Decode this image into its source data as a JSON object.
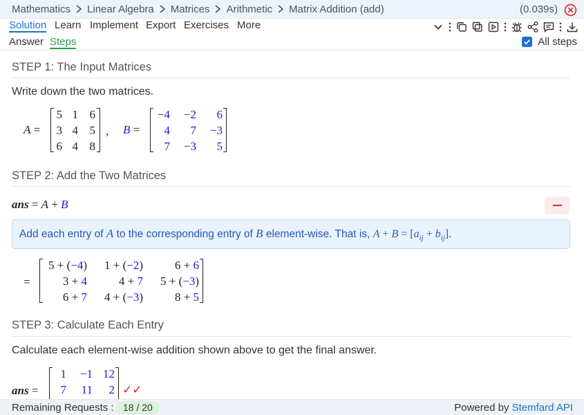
{
  "breadcrumb": [
    "Mathematics",
    "Linear Algebra",
    "Matrices",
    "Arithmetic",
    "Matrix Addition (add)"
  ],
  "timing": "(0.039s)",
  "menu": [
    "Solution",
    "Learn",
    "Implement",
    "Export",
    "Exercises",
    "More"
  ],
  "subtabs": [
    "Answer",
    "Steps"
  ],
  "all_steps_label": "All steps",
  "all_steps_checked": true,
  "steps": {
    "step1": {
      "title": "STEP 1: The Input Matrices",
      "text": "Write down the two matrices.",
      "A": [
        [
          "5",
          "1",
          "6"
        ],
        [
          "3",
          "4",
          "5"
        ],
        [
          "6",
          "4",
          "8"
        ]
      ],
      "B": [
        [
          "−4",
          "−2",
          "6"
        ],
        [
          "4",
          "7",
          "−3"
        ],
        [
          "7",
          "−3",
          "5"
        ]
      ]
    },
    "step2": {
      "title": "STEP 2: Add the Two Matrices",
      "info_prefix": "Add each entry of",
      "info_mid": "to the corresponding entry of",
      "info_suffix": "element-wise. That is,",
      "sum": [
        [
          [
            "5",
            "−4"
          ],
          [
            "1",
            "−2"
          ],
          [
            "6",
            "6"
          ]
        ],
        [
          [
            "3",
            "4"
          ],
          [
            "4",
            "7"
          ],
          [
            "5",
            "−3"
          ]
        ],
        [
          [
            "6",
            "7"
          ],
          [
            "4",
            "−3"
          ],
          [
            "8",
            "5"
          ]
        ]
      ]
    },
    "step3": {
      "title": "STEP 3: Calculate Each Entry",
      "text": "Calculate each element-wise addition shown above to get the final answer.",
      "result": [
        [
          "1",
          "−1",
          "12"
        ],
        [
          "7",
          "11",
          "2"
        ]
      ]
    }
  },
  "footer": {
    "label": "Remaining Requests :",
    "quota": "18 / 20",
    "powered_prefix": "Powered by",
    "powered_link": "Stemfard API"
  },
  "colors": {
    "accent": "#1a73c9",
    "steps_tab": "#2a9d4b",
    "math_blue": "#1c1cd4",
    "check_red": "#e02020"
  },
  "icons": [
    "chevron-right-icon",
    "close-circle-icon",
    "chevron-down-icon",
    "copy-icon",
    "duplicate-icon",
    "play-icon",
    "bug-icon",
    "share-icon",
    "comment-icon",
    "download-icon",
    "minus-icon",
    "check-icon"
  ]
}
